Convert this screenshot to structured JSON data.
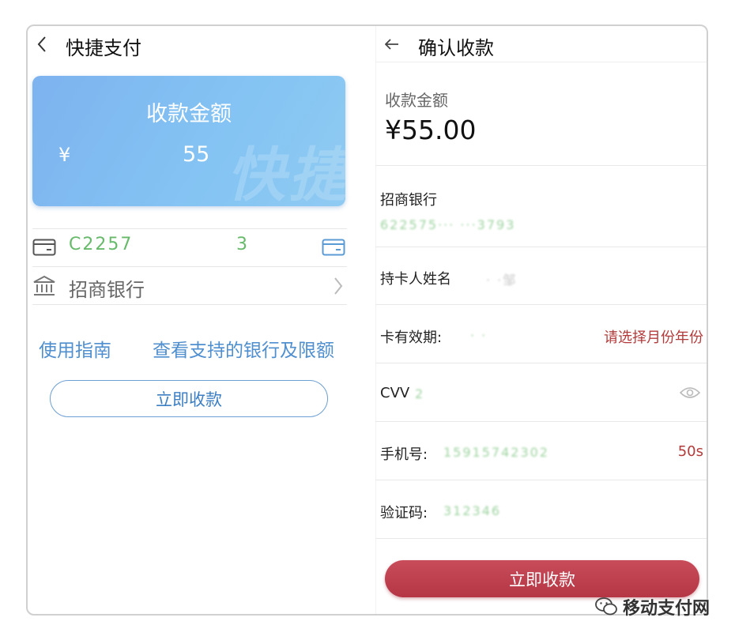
{
  "left": {
    "title": "快捷支付",
    "card": {
      "title": "收款金额",
      "currency": "¥",
      "amount": "55",
      "watermark": "快捷"
    },
    "card_number": "C2257",
    "card_number_tail": "3",
    "bank_name": "招商银行",
    "links": {
      "guide": "使用指南",
      "supported_banks": "查看支持的银行及限额"
    },
    "confirm_button": "立即收款"
  },
  "right": {
    "title": "确认收款",
    "amount_label": "收款金额",
    "amount_value": "¥55.00",
    "bank_name": "招商银行",
    "bank_card_masked": "622575··· ···3793",
    "holder_label": "持卡人姓名",
    "holder_masked": "·  ·邹",
    "expiry_label": "卡有效期:",
    "expiry_masked": "·  ·",
    "expiry_prompt": "请选择月份年份",
    "cvv_label": "CVV",
    "cvv_masked": "2",
    "phone_label": "手机号:",
    "phone_masked": "15915742302",
    "countdown": "50s",
    "code_label": "验证码:",
    "code_value": "312346",
    "confirm_button": "立即收款"
  },
  "watermark": "移动支付网",
  "colors": {
    "link_blue": "#4f8fcf",
    "card_gradient_start": "#7db3ef",
    "confirm_red": "#b53645",
    "warning_red": "#b33a3a",
    "masked_green": "#4caf50"
  },
  "icons": {
    "left_back": "chevron-left-icon",
    "right_back": "arrow-left-icon",
    "card": "credit-card-icon",
    "bank": "bank-building-icon",
    "chevron": "chevron-right-icon",
    "eye": "eye-icon",
    "wechat": "wechat-icon"
  }
}
